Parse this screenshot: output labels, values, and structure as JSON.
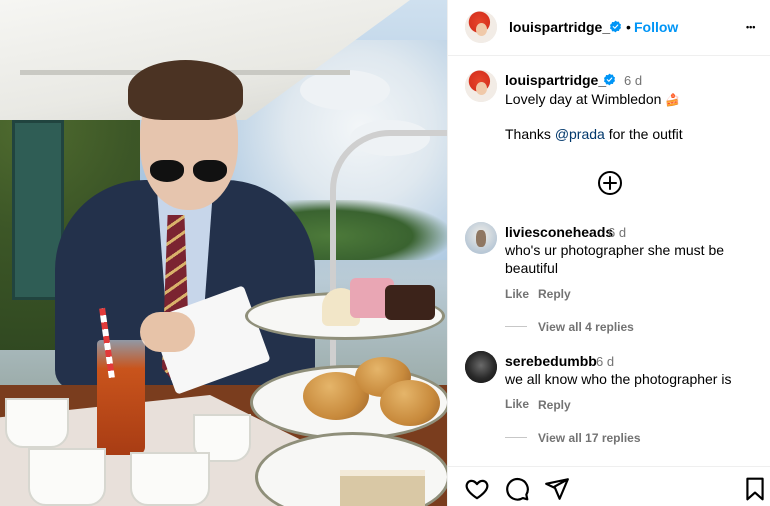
{
  "post": {
    "author": "louispartridge_",
    "follow_separator": "•",
    "follow_label": "Follow",
    "more_label": "•••",
    "caption": {
      "author": "louispartridge_",
      "time": "6 d",
      "line1": "Lovely day at Wimbledon",
      "line1_emoji": "🍰",
      "line2_prefix": "Thanks ",
      "mention": "@prada",
      "line2_suffix": " for the outfit"
    },
    "load_more_icon": "plus-circle-icon"
  },
  "comments": [
    {
      "author": "liviesconeheads",
      "time": "6 d",
      "text_line1": "who's ur photographer she must be",
      "text_line2": "beautiful",
      "like_label": "Like",
      "reply_label": "Reply",
      "view_replies": "View all 4 replies"
    },
    {
      "author": "serebedumbb",
      "time": "6 d",
      "text_line1": "we all know who the photographer is",
      "like_label": "Like",
      "reply_label": "Reply",
      "view_replies": "View all 17 replies"
    }
  ],
  "actions": {
    "icons": [
      "heart-icon",
      "comment-icon",
      "share-icon",
      "bookmark-icon"
    ]
  },
  "colors": {
    "follow": "#0095f6",
    "mention": "#00376b",
    "secondary_text": "#737373",
    "verified": "#0095f6"
  }
}
